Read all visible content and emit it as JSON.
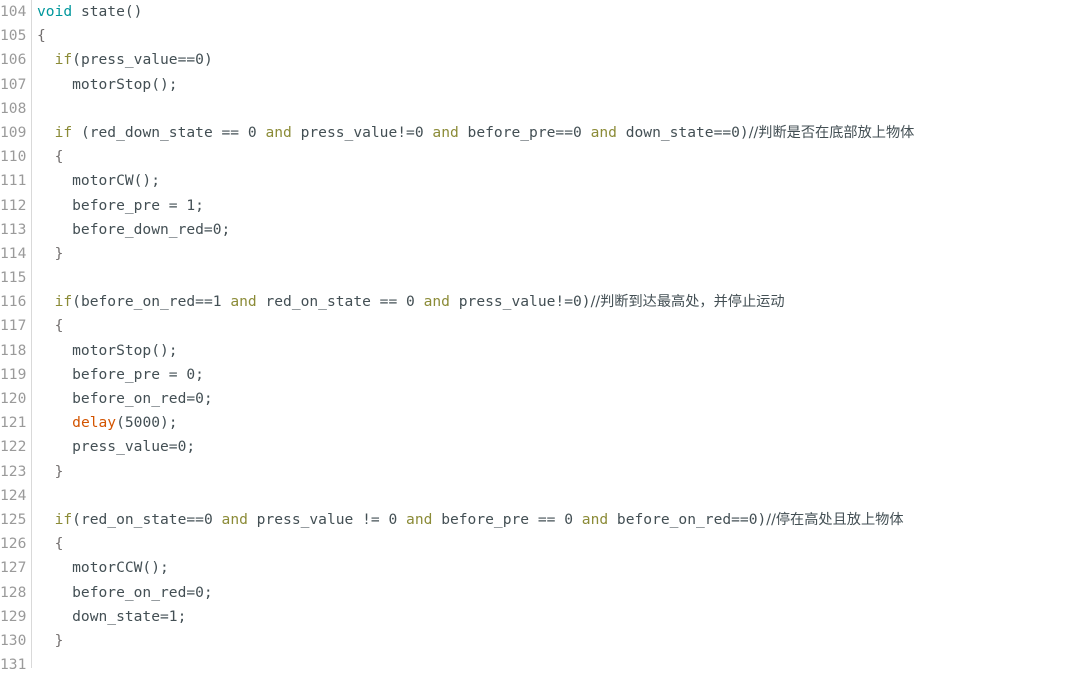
{
  "editor": {
    "name": "arduino-code-editor",
    "language": "arduino-cpp",
    "background_color": "#ffffff",
    "gutter_color": "#9a9a9a",
    "gutter_rule_color": "#d9d9d9",
    "default_text_color": "#434f54",
    "colors": {
      "type_keyword": "#00979c",
      "control_keyword": "#8b8b37",
      "builtin_function": "#d35400",
      "comment": "#434f54",
      "brace": "#726e6e"
    },
    "first_line_number": 104,
    "last_line_number": 131,
    "line_height_px": 24.2,
    "font_size_px": 14.6
  },
  "lines": [
    {
      "number": "104",
      "tokens": [
        {
          "text": "void",
          "kind": "type"
        },
        {
          "text": " state()",
          "kind": "plain"
        }
      ]
    },
    {
      "number": "105",
      "tokens": [
        {
          "text": "{",
          "kind": "brace"
        }
      ]
    },
    {
      "number": "106",
      "tokens": [
        {
          "text": "  ",
          "kind": "plain"
        },
        {
          "text": "if",
          "kind": "kw"
        },
        {
          "text": "(press_value==0)",
          "kind": "plain"
        }
      ]
    },
    {
      "number": "107",
      "tokens": [
        {
          "text": "    motorStop();",
          "kind": "plain"
        }
      ]
    },
    {
      "number": "108",
      "tokens": []
    },
    {
      "number": "109",
      "tokens": [
        {
          "text": "  ",
          "kind": "plain"
        },
        {
          "text": "if",
          "kind": "kw"
        },
        {
          "text": " (red_down_state == 0 ",
          "kind": "plain"
        },
        {
          "text": "and",
          "kind": "kw"
        },
        {
          "text": " press_value!=0 ",
          "kind": "plain"
        },
        {
          "text": "and",
          "kind": "kw"
        },
        {
          "text": " before_pre==0 ",
          "kind": "plain"
        },
        {
          "text": "and",
          "kind": "kw"
        },
        {
          "text": " down_state==0)",
          "kind": "plain"
        },
        {
          "text": "//判断是否在底部放上物体",
          "kind": "comment"
        }
      ]
    },
    {
      "number": "110",
      "tokens": [
        {
          "text": "  ",
          "kind": "plain"
        },
        {
          "text": "{",
          "kind": "brace"
        }
      ]
    },
    {
      "number": "111",
      "tokens": [
        {
          "text": "    motorCW();",
          "kind": "plain"
        }
      ]
    },
    {
      "number": "112",
      "tokens": [
        {
          "text": "    before_pre = 1;",
          "kind": "plain"
        }
      ]
    },
    {
      "number": "113",
      "tokens": [
        {
          "text": "    before_down_red=0;",
          "kind": "plain"
        }
      ]
    },
    {
      "number": "114",
      "tokens": [
        {
          "text": "  ",
          "kind": "plain"
        },
        {
          "text": "}",
          "kind": "brace"
        }
      ]
    },
    {
      "number": "115",
      "tokens": []
    },
    {
      "number": "116",
      "tokens": [
        {
          "text": "  ",
          "kind": "plain"
        },
        {
          "text": "if",
          "kind": "kw"
        },
        {
          "text": "(before_on_red==1 ",
          "kind": "plain"
        },
        {
          "text": "and",
          "kind": "kw"
        },
        {
          "text": " red_on_state == 0 ",
          "kind": "plain"
        },
        {
          "text": "and",
          "kind": "kw"
        },
        {
          "text": " press_value!=0)",
          "kind": "plain"
        },
        {
          "text": "//判断到达最高处，并停止运动",
          "kind": "comment"
        }
      ]
    },
    {
      "number": "117",
      "tokens": [
        {
          "text": "  ",
          "kind": "plain"
        },
        {
          "text": "{",
          "kind": "brace"
        }
      ]
    },
    {
      "number": "118",
      "tokens": [
        {
          "text": "    motorStop();",
          "kind": "plain"
        }
      ]
    },
    {
      "number": "119",
      "tokens": [
        {
          "text": "    before_pre = 0;",
          "kind": "plain"
        }
      ]
    },
    {
      "number": "120",
      "tokens": [
        {
          "text": "    before_on_red=0;",
          "kind": "plain"
        }
      ]
    },
    {
      "number": "121",
      "tokens": [
        {
          "text": "    ",
          "kind": "plain"
        },
        {
          "text": "delay",
          "kind": "fn"
        },
        {
          "text": "(5000);",
          "kind": "plain"
        }
      ]
    },
    {
      "number": "122",
      "tokens": [
        {
          "text": "    press_value=0;",
          "kind": "plain"
        }
      ]
    },
    {
      "number": "123",
      "tokens": [
        {
          "text": "  ",
          "kind": "plain"
        },
        {
          "text": "}",
          "kind": "brace"
        }
      ]
    },
    {
      "number": "124",
      "tokens": []
    },
    {
      "number": "125",
      "tokens": [
        {
          "text": "  ",
          "kind": "plain"
        },
        {
          "text": "if",
          "kind": "kw"
        },
        {
          "text": "(red_on_state==0 ",
          "kind": "plain"
        },
        {
          "text": "and",
          "kind": "kw"
        },
        {
          "text": " press_value != 0 ",
          "kind": "plain"
        },
        {
          "text": "and",
          "kind": "kw"
        },
        {
          "text": " before_pre == 0 ",
          "kind": "plain"
        },
        {
          "text": "and",
          "kind": "kw"
        },
        {
          "text": " before_on_red==0)",
          "kind": "plain"
        },
        {
          "text": "//停在高处且放上物体",
          "kind": "comment"
        }
      ]
    },
    {
      "number": "126",
      "tokens": [
        {
          "text": "  ",
          "kind": "plain"
        },
        {
          "text": "{",
          "kind": "brace"
        }
      ]
    },
    {
      "number": "127",
      "tokens": [
        {
          "text": "    motorCCW();",
          "kind": "plain"
        }
      ]
    },
    {
      "number": "128",
      "tokens": [
        {
          "text": "    before_on_red=0;",
          "kind": "plain"
        }
      ]
    },
    {
      "number": "129",
      "tokens": [
        {
          "text": "    down_state=1;",
          "kind": "plain"
        }
      ]
    },
    {
      "number": "130",
      "tokens": [
        {
          "text": "  ",
          "kind": "plain"
        },
        {
          "text": "}",
          "kind": "brace"
        }
      ]
    },
    {
      "number": "131",
      "tokens": []
    }
  ]
}
